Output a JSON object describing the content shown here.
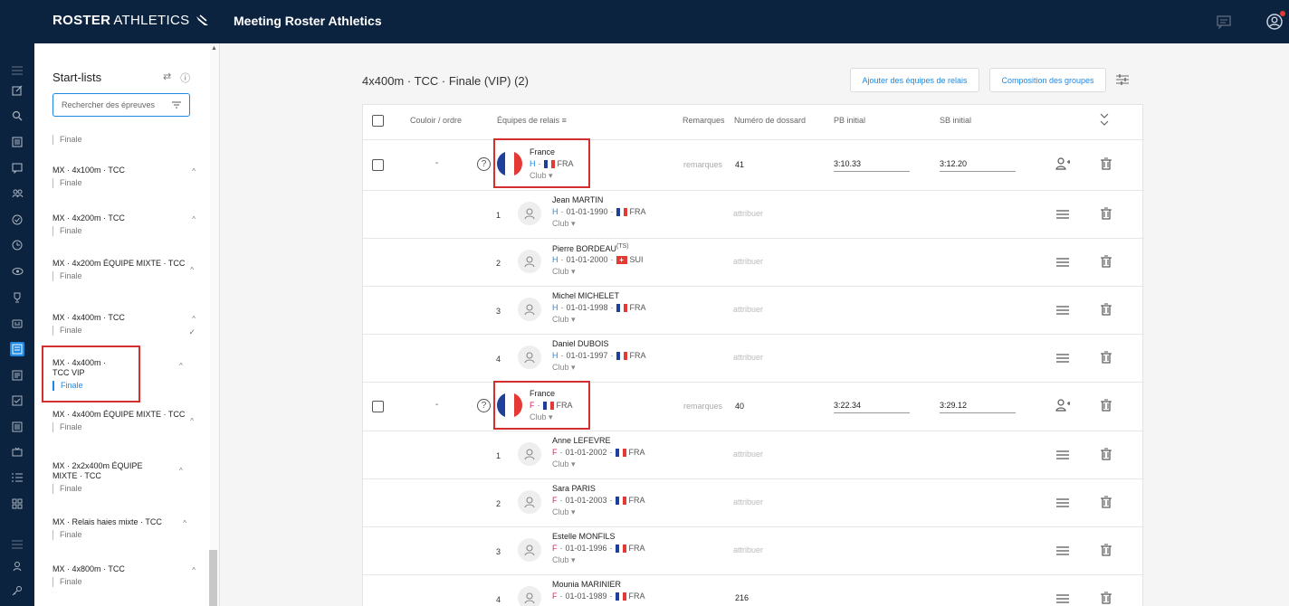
{
  "header": {
    "logo_bold": "ROSTER",
    "logo_light": "ATHLETICS",
    "title": "Meeting Roster Athletics"
  },
  "colors": {
    "navy": "#0c2340",
    "accent": "#1e88e5",
    "highlight": "#d32f2f"
  },
  "sidebar": {
    "title": "Start-lists",
    "search_placeholder": "Rechercher des épreuves",
    "events": [
      {
        "name": "",
        "round": "Finale"
      },
      {
        "name": "MX · 4x100m · TCC",
        "round": "Finale"
      },
      {
        "name": "MX · 4x200m · TCC",
        "round": "Finale"
      },
      {
        "name": "MX · 4x200m ÉQUIPE MIXTE · TCC",
        "round": "Finale"
      },
      {
        "name": "MX · 4x400m · TCC",
        "round": "Finale"
      },
      {
        "name": "MX · 4x400m · TCC VIP",
        "round": "Finale"
      },
      {
        "name": "MX · 4x400m ÉQUIPE MIXTE · TCC",
        "round": "Finale"
      },
      {
        "name": "MX · 2x2x400m ÉQUIPE MIXTE · TCC",
        "round": "Finale"
      },
      {
        "name": "MX · Relais haies mixte · TCC",
        "round": "Finale"
      },
      {
        "name": "MX · 4x800m · TCC",
        "round": "Finale"
      }
    ]
  },
  "main": {
    "heading": "4x400m · TCC · Finale (VIP) (2)",
    "buttons": {
      "add_teams": "Ajouter des équipes de relais",
      "groups": "Composition des groupes"
    },
    "columns": {
      "lane": "Couloir / ordre",
      "teams": "Équipes de relais",
      "remarks": "Remarques",
      "bib": "Numéro de dossard",
      "pb": "PB initial",
      "sb": "SB initial"
    },
    "labels": {
      "dash": "-",
      "remarks": "remarques",
      "assign": "attribuer",
      "club": "Club ▾",
      "help": "?"
    },
    "teams": [
      {
        "name": "France",
        "sex": "H",
        "nat": "FRA",
        "bib": "41",
        "pb": "3:10.33",
        "sb": "3:12.20",
        "athletes": [
          {
            "order": "1",
            "name": "Jean MARTIN",
            "sex": "H",
            "dob": "01-01-1990",
            "nat": "FRA",
            "tag": "",
            "bib": "attribuer"
          },
          {
            "order": "2",
            "name": "Pierre BORDEAU",
            "sex": "H",
            "dob": "01-01-2000",
            "nat": "SUI",
            "tag": "(TS)",
            "bib": "attribuer"
          },
          {
            "order": "3",
            "name": "Michel MICHELET",
            "sex": "H",
            "dob": "01-01-1998",
            "nat": "FRA",
            "tag": "",
            "bib": "attribuer"
          },
          {
            "order": "4",
            "name": "Daniel DUBOIS",
            "sex": "H",
            "dob": "01-01-1997",
            "nat": "FRA",
            "tag": "",
            "bib": "attribuer"
          }
        ]
      },
      {
        "name": "France",
        "sex": "F",
        "nat": "FRA",
        "bib": "40",
        "pb": "3:22.34",
        "sb": "3:29.12",
        "athletes": [
          {
            "order": "1",
            "name": "Anne LEFEVRE",
            "sex": "F",
            "dob": "01-01-2002",
            "nat": "FRA",
            "tag": "",
            "bib": "attribuer"
          },
          {
            "order": "2",
            "name": "Sara PARIS",
            "sex": "F",
            "dob": "01-01-2003",
            "nat": "FRA",
            "tag": "",
            "bib": "attribuer"
          },
          {
            "order": "3",
            "name": "Estelle MONFILS",
            "sex": "F",
            "dob": "01-01-1996",
            "nat": "FRA",
            "tag": "",
            "bib": "attribuer"
          },
          {
            "order": "4",
            "name": "Mounia MARINIER",
            "sex": "F",
            "dob": "01-01-1989",
            "nat": "FRA",
            "tag": "",
            "bib": "216"
          }
        ]
      }
    ]
  }
}
